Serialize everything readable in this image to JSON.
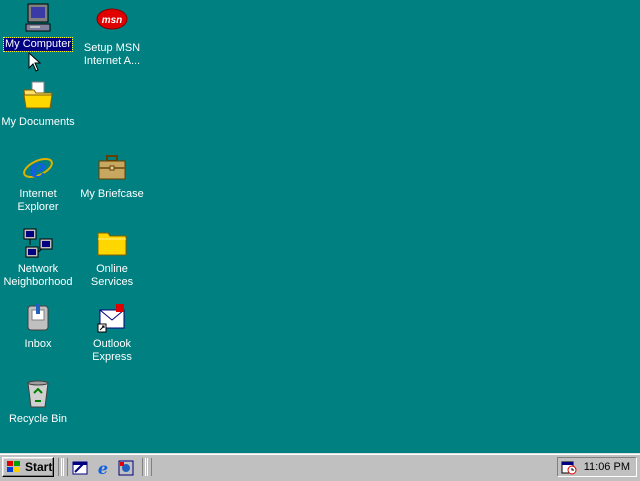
{
  "desktop": {
    "background_color": "#008080",
    "icons": [
      {
        "label": "My Computer",
        "icon": "my-computer-icon",
        "selected": true
      },
      {
        "label": "Setup MSN\nInternet A...",
        "icon": "msn-icon"
      },
      {
        "label": "My Documents",
        "icon": "folder-documents-icon"
      },
      {
        "label": "Internet\nExplorer",
        "icon": "internet-explorer-icon"
      },
      {
        "label": "My Briefcase",
        "icon": "briefcase-icon"
      },
      {
        "label": "Network\nNeighborhood",
        "icon": "network-icon"
      },
      {
        "label": "Online\nServices",
        "icon": "folder-icon"
      },
      {
        "label": "Inbox",
        "icon": "inbox-icon"
      },
      {
        "label": "Outlook\nExpress",
        "icon": "outlook-express-icon"
      },
      {
        "label": "Recycle Bin",
        "icon": "recycle-bin-icon"
      }
    ]
  },
  "taskbar": {
    "start_label": "Start",
    "quick_launch": [
      "show-desktop-icon",
      "internet-explorer-icon",
      "channels-icon"
    ],
    "clock": "11:06 PM",
    "tray_icon": "scheduler-icon"
  }
}
